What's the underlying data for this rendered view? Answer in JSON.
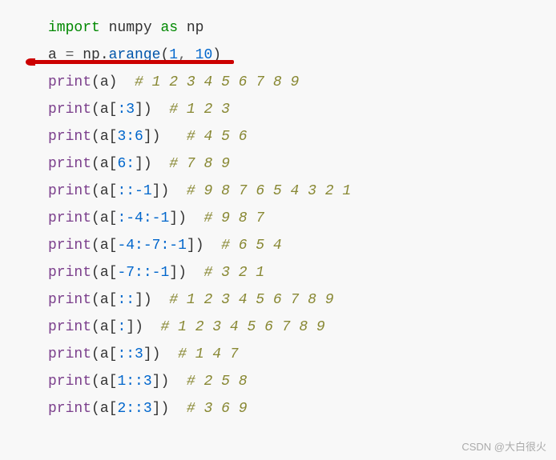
{
  "lines": {
    "l1_import": "import",
    "l1_module": " numpy ",
    "l1_as": "as",
    "l1_alias": " np",
    "l2_var": "a ",
    "l2_eq": "= ",
    "l2_obj": "np.",
    "l2_method": "arange",
    "l2_open": "(",
    "l2_arg1": "1",
    "l2_comma": ", ",
    "l2_arg2": "10",
    "l2_close": ")",
    "print_label": "print",
    "open_p": "(",
    "close_p": ")",
    "arg_a": "a",
    "open_b": "[",
    "close_b": "]",
    "s3": ":3",
    "s36": "3:6",
    "s6": "6:",
    "sn1": "::-1",
    "sn4n1": ":-4:-1",
    "sn4n7n1": "-4:-7:-1",
    "sn7n1": "-7::-1",
    "scc": "::",
    "sc": ":",
    "sc3": "::3",
    "s1c3": "1::3",
    "s2c3": "2::3",
    "c1": "  # 1 2 3 4 5 6 7 8 9",
    "c2": "  # 1 2 3",
    "c3": "   # 4 5 6",
    "c4": "  # 7 8 9",
    "c5": "  # 9 8 7 6 5 4 3 2 1",
    "c6": "  # 9 8 7",
    "c7": "  # 6 5 4",
    "c8": "  # 3 2 1",
    "c9": "  # 1 2 3 4 5 6 7 8 9",
    "c10": "  # 1 2 3 4 5 6 7 8 9",
    "c11": "  # 1 4 7",
    "c12": "  # 2 5 8",
    "c13": "  # 3 6 9"
  },
  "watermark": "CSDN @大白很火"
}
